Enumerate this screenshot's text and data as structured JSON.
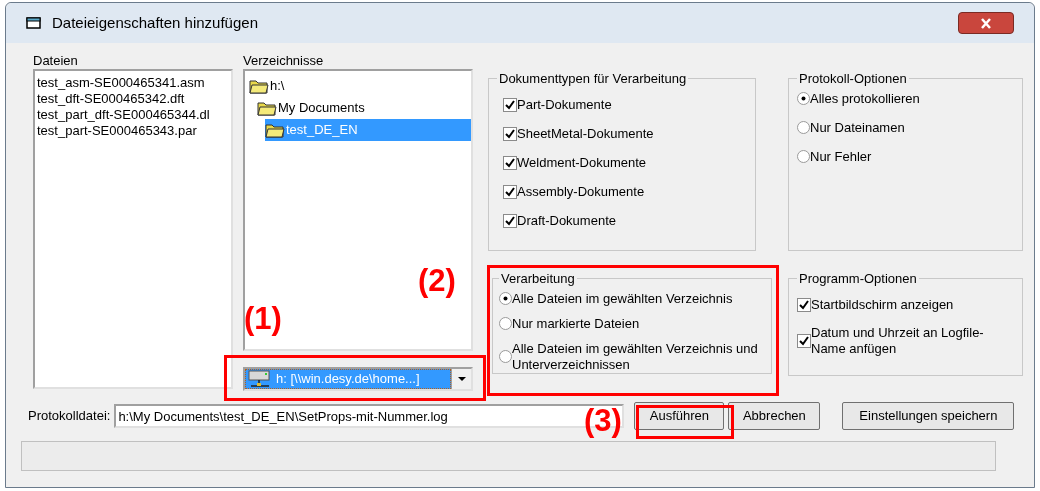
{
  "window": {
    "title": "Dateieigenschaften hinzufügen"
  },
  "files": {
    "label": "Dateien",
    "items": [
      "test_asm-SE000465341.asm",
      "test_dft-SE000465342.dft",
      "test_part_dft-SE000465344.dl",
      "test_part-SE000465343.par"
    ]
  },
  "directories": {
    "label": "Verzeichnisse",
    "tree": [
      {
        "label": "h:\\",
        "selected": false,
        "children": [
          {
            "label": "My Documents",
            "selected": false,
            "children": [
              {
                "label": "test_DE_EN",
                "selected": true
              }
            ]
          }
        ]
      }
    ]
  },
  "drive": {
    "value": "h: [\\\\win.desy.de\\home...]"
  },
  "document_types": {
    "title": "Dokumenttypen für Verarbeitung",
    "options": [
      {
        "label": "Part-Dokumente",
        "checked": true
      },
      {
        "label": "SheetMetal-Dokumente",
        "checked": true
      },
      {
        "label": "Weldment-Dokumente",
        "checked": true
      },
      {
        "label": "Assembly-Dokumente",
        "checked": true
      },
      {
        "label": "Draft-Dokumente",
        "checked": true
      }
    ]
  },
  "log_options": {
    "title": "Protokoll-Optionen",
    "options": [
      {
        "label": "Alles protokollieren",
        "selected": true
      },
      {
        "label": "Nur Dateinamen",
        "selected": false
      },
      {
        "label": "Nur Fehler",
        "selected": false
      }
    ]
  },
  "processing": {
    "title": "Verarbeitung",
    "options": [
      {
        "label": "Alle Dateien im gewählten Verzeichnis",
        "selected": true
      },
      {
        "label": "Nur markierte Dateien",
        "selected": false
      },
      {
        "label": "Alle Dateien im gewählten Verzeichnis und Unterverzeichnissen",
        "selected": false
      }
    ]
  },
  "program_options": {
    "title": "Programm-Optionen",
    "options": [
      {
        "label": "Startbildschirm anzeigen",
        "checked": true
      },
      {
        "label": "Datum und Uhrzeit an Logfile-Name anfügen",
        "checked": true
      }
    ]
  },
  "log_file": {
    "label": "Protokolldatei:",
    "value": "h:\\My Documents\\test_DE_EN\\SetProps-mit-Nummer.log"
  },
  "buttons": [
    {
      "label": "Ausführen"
    },
    {
      "label": "Abbrechen"
    },
    {
      "label": "Einstellungen speichern"
    }
  ],
  "annotations": [
    {
      "label": "(1)"
    },
    {
      "label": "(2)"
    },
    {
      "label": "(3)"
    }
  ]
}
